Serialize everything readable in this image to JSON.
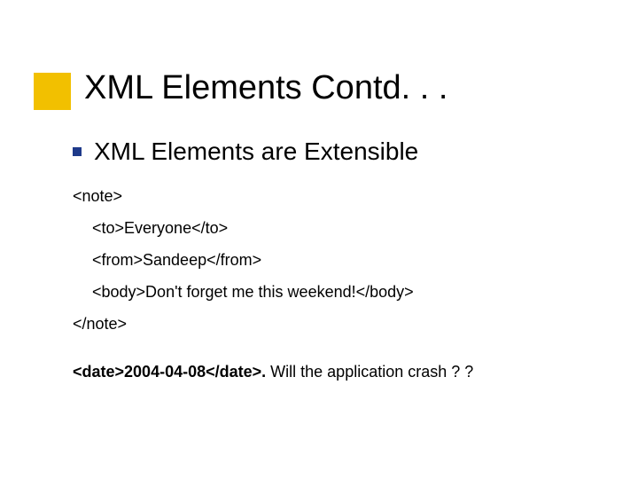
{
  "title": "XML Elements Contd. . .",
  "bullet1": "XML Elements are Extensible",
  "code": {
    "open_note": "<note>",
    "to": "<to>Everyone</to>",
    "from": "<from>Sandeep</from>",
    "body": "<body>Don't forget me this weekend!</body>",
    "close_note": "</note>"
  },
  "question": {
    "bold_part": "<date>2004-04-08</date>.",
    "rest": " Will the application crash ? ?"
  }
}
